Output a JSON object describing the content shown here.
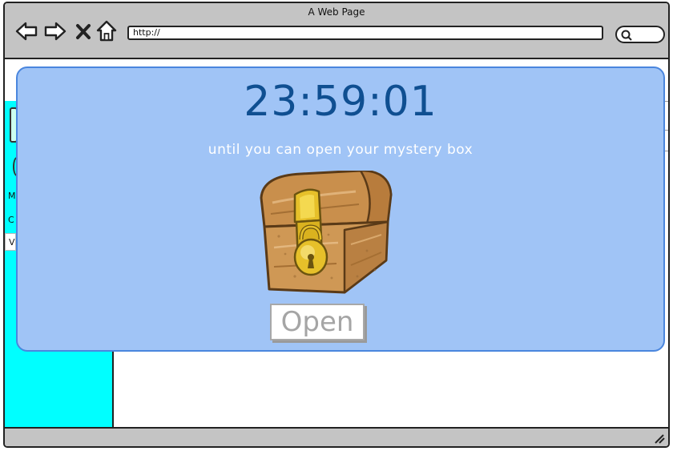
{
  "browser": {
    "window_title": "A Web Page",
    "url": "http://",
    "icons": {
      "back": "back-arrow-icon",
      "forward": "forward-arrow-icon",
      "stop": "close-icon",
      "home": "home-icon",
      "search": "search-icon"
    }
  },
  "sidebar": {
    "color": "#00ffff",
    "items": [
      "M",
      "C",
      "V"
    ]
  },
  "modal": {
    "countdown": "23:59:01",
    "caption": "until you can open your mystery box",
    "chest_icon": "treasure-chest-icon",
    "open_button_label": "Open",
    "background_color": "#a0c4f6",
    "countdown_color": "#0f4f91"
  }
}
